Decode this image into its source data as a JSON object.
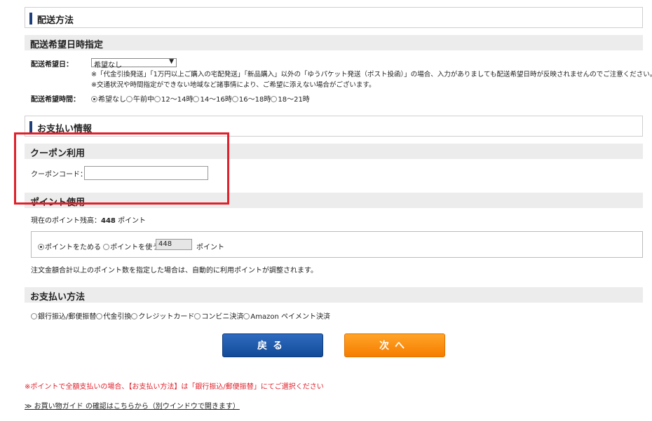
{
  "delivery": {
    "section_title": "配送方法",
    "date_subhead": "配送希望日時指定",
    "date_label": "配送希望日：",
    "date_select_value": "希望なし",
    "note1": "※「代金引換発送」「1万円以上ご購入の宅配発送」「新品購入」以外の「ゆうパケット発送（ポスト投函）」の場合、入力がありましても配送希望日時が反映されませんのでご注意ください。",
    "note2": "※交通状況や時間指定ができない地域など諸事情により、ご希望に添えない場合がございます。",
    "time_label": "配送希望時間：",
    "time_options": [
      "希望なし",
      "午前中",
      "12～14時",
      "14～16時",
      "16～18時",
      "18～21時"
    ],
    "time_selected": 0
  },
  "payment_info": {
    "section_title": "お支払い情報"
  },
  "coupon": {
    "subhead": "クーポン利用",
    "code_label": "クーポンコード：",
    "code_value": ""
  },
  "points": {
    "subhead": "ポイント使用",
    "balance_label": "現在のポイント残高：",
    "balance_value": "448",
    "balance_unit": "ポイント",
    "option_save": "ポイントをためる",
    "option_use": "ポイントを使う",
    "use_value": "448",
    "use_unit": "ポイント",
    "selected": "save",
    "note": "注文金額合計以上のポイント数を指定した場合は、自動的に利用ポイントが調整されます。"
  },
  "payment_method": {
    "subhead": "お支払い方法",
    "options": [
      "銀行振込/郵便振替",
      "代金引換",
      "クレジットカード",
      "コンビニ決済",
      "Amazon ペイメント決済"
    ]
  },
  "buttons": {
    "back": "戻る",
    "next": "次へ"
  },
  "footer": {
    "red_note": "※ポイントで全額支払いの場合、【お支払い方法】は「銀行振込/郵便振替」にてご選択ください",
    "guide_link": "≫ お買い物ガイド の確認はこちらから（別ウインドウで開きます）"
  },
  "colors": {
    "accent_bar": "#1e3f7a",
    "highlight_frame": "#e0202a",
    "back_button": "#1a5aad",
    "next_button": "#f78a10"
  }
}
